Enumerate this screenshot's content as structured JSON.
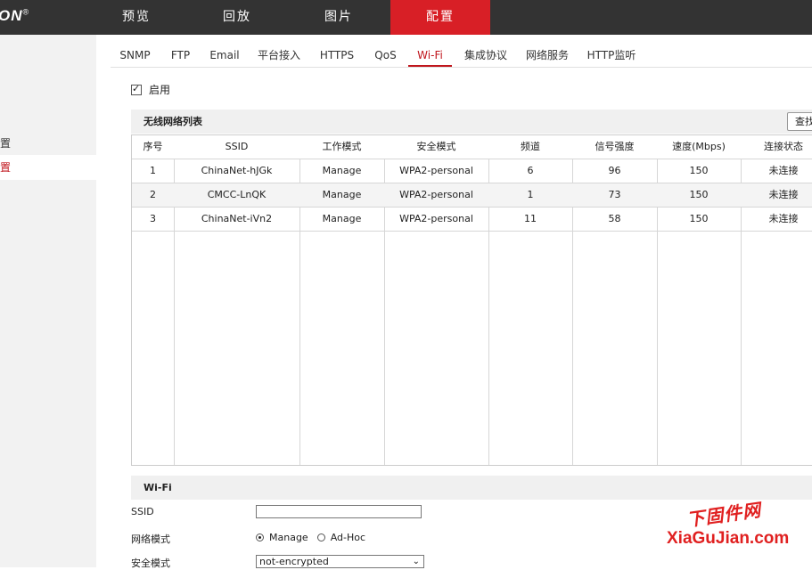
{
  "brand": {
    "logo_text": "ON",
    "reg_mark": "®"
  },
  "top_nav": [
    {
      "label": "预览"
    },
    {
      "label": "回放"
    },
    {
      "label": "图片"
    },
    {
      "label": "配置"
    }
  ],
  "sidebar": {
    "items": [
      {
        "label": "置"
      },
      {
        "label": "置"
      }
    ]
  },
  "tabs": [
    {
      "label": "SNMP"
    },
    {
      "label": "FTP"
    },
    {
      "label": "Email"
    },
    {
      "label": "平台接入"
    },
    {
      "label": "HTTPS"
    },
    {
      "label": "QoS"
    },
    {
      "label": "Wi-Fi"
    },
    {
      "label": "集成协议"
    },
    {
      "label": "网络服务"
    },
    {
      "label": "HTTP监听"
    }
  ],
  "enable": {
    "label": "启用",
    "checked": true
  },
  "wifi_list": {
    "title": "无线网络列表",
    "search_label": "查找",
    "columns": [
      "序号",
      "SSID",
      "工作模式",
      "安全模式",
      "频道",
      "信号强度",
      "速度(Mbps)",
      "连接状态"
    ],
    "rows": [
      [
        "1",
        "ChinaNet-hJGk",
        "Manage",
        "WPA2-personal",
        "6",
        "96",
        "150",
        "未连接"
      ],
      [
        "2",
        "CMCC-LnQK",
        "Manage",
        "WPA2-personal",
        "1",
        "73",
        "150",
        "未连接"
      ],
      [
        "3",
        "ChinaNet-iVn2",
        "Manage",
        "WPA2-personal",
        "11",
        "58",
        "150",
        "未连接"
      ]
    ]
  },
  "wifi_form": {
    "title": "Wi-Fi",
    "ssid_label": "SSID",
    "ssid_value": "",
    "mode_label": "网络模式",
    "mode_options": [
      "Manage",
      "Ad-Hoc"
    ],
    "mode_selected": "Manage",
    "security_label": "安全模式",
    "security_value": "not-encrypted"
  },
  "watermark": {
    "line1": "下固件网",
    "line2": "XiaGuJian.com"
  },
  "colors": {
    "accent": "#d81f26",
    "topbar": "#333333",
    "sidebar": "#f2f2f2"
  }
}
